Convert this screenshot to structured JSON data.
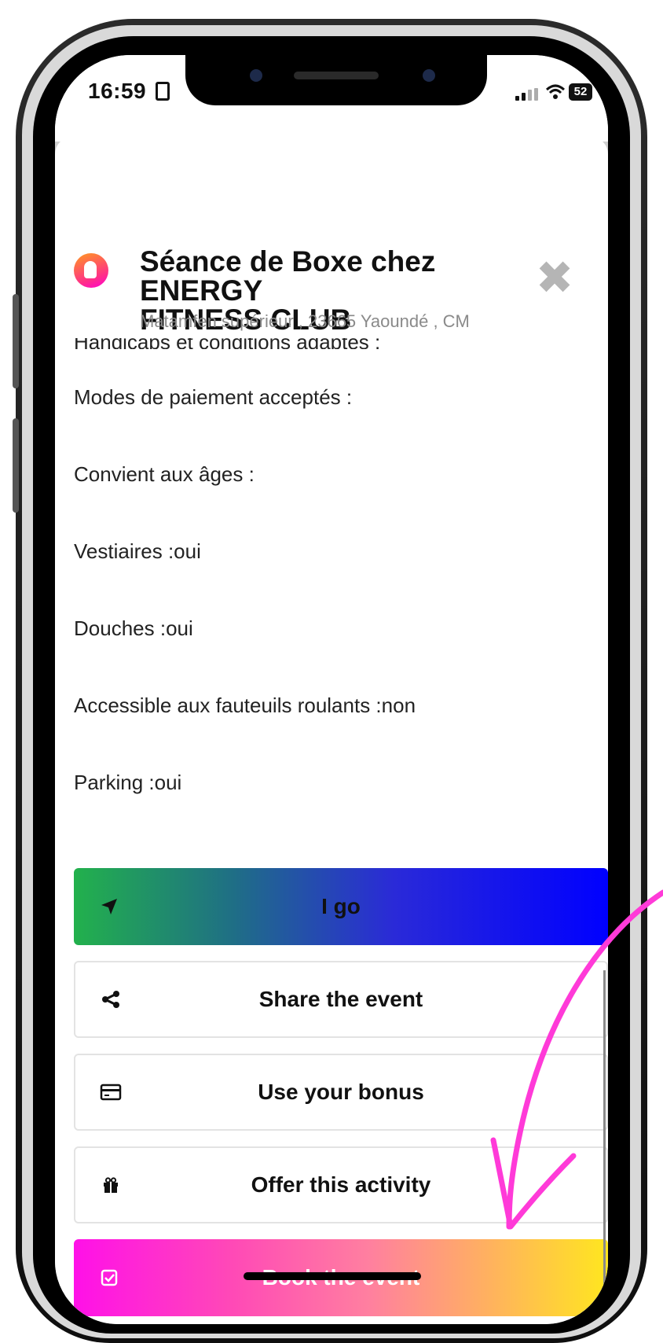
{
  "status_bar": {
    "time": "16:59",
    "battery": "52"
  },
  "header": {
    "title_line1": "Séance  de Boxe chez ENERGY",
    "title_line2": "FITNESS CLUB",
    "address": "Matamfen supérieur , 23665 Yaoundé , CM",
    "close_icon": "close-icon"
  },
  "details": {
    "partial_text": "Handicaps et conditions adaptés :",
    "rows": [
      "Modes de paiement acceptés :",
      "Convient aux âges :",
      "Vestiaires :oui",
      "Douches :oui",
      "Accessible aux fauteuils roulants :non",
      "Parking :oui"
    ]
  },
  "actions": {
    "go_label": "I go",
    "share_label": "Share the event",
    "bonus_label": "Use your bonus",
    "offer_label": "Offer this activity",
    "book_label": "Book the event"
  },
  "colors": {
    "book_gradient": [
      "#ff10e8",
      "#ffe61f"
    ],
    "go_gradient": [
      "#22b14c",
      "#0000ff"
    ],
    "annotation_arrow": "#ff3ad8"
  }
}
